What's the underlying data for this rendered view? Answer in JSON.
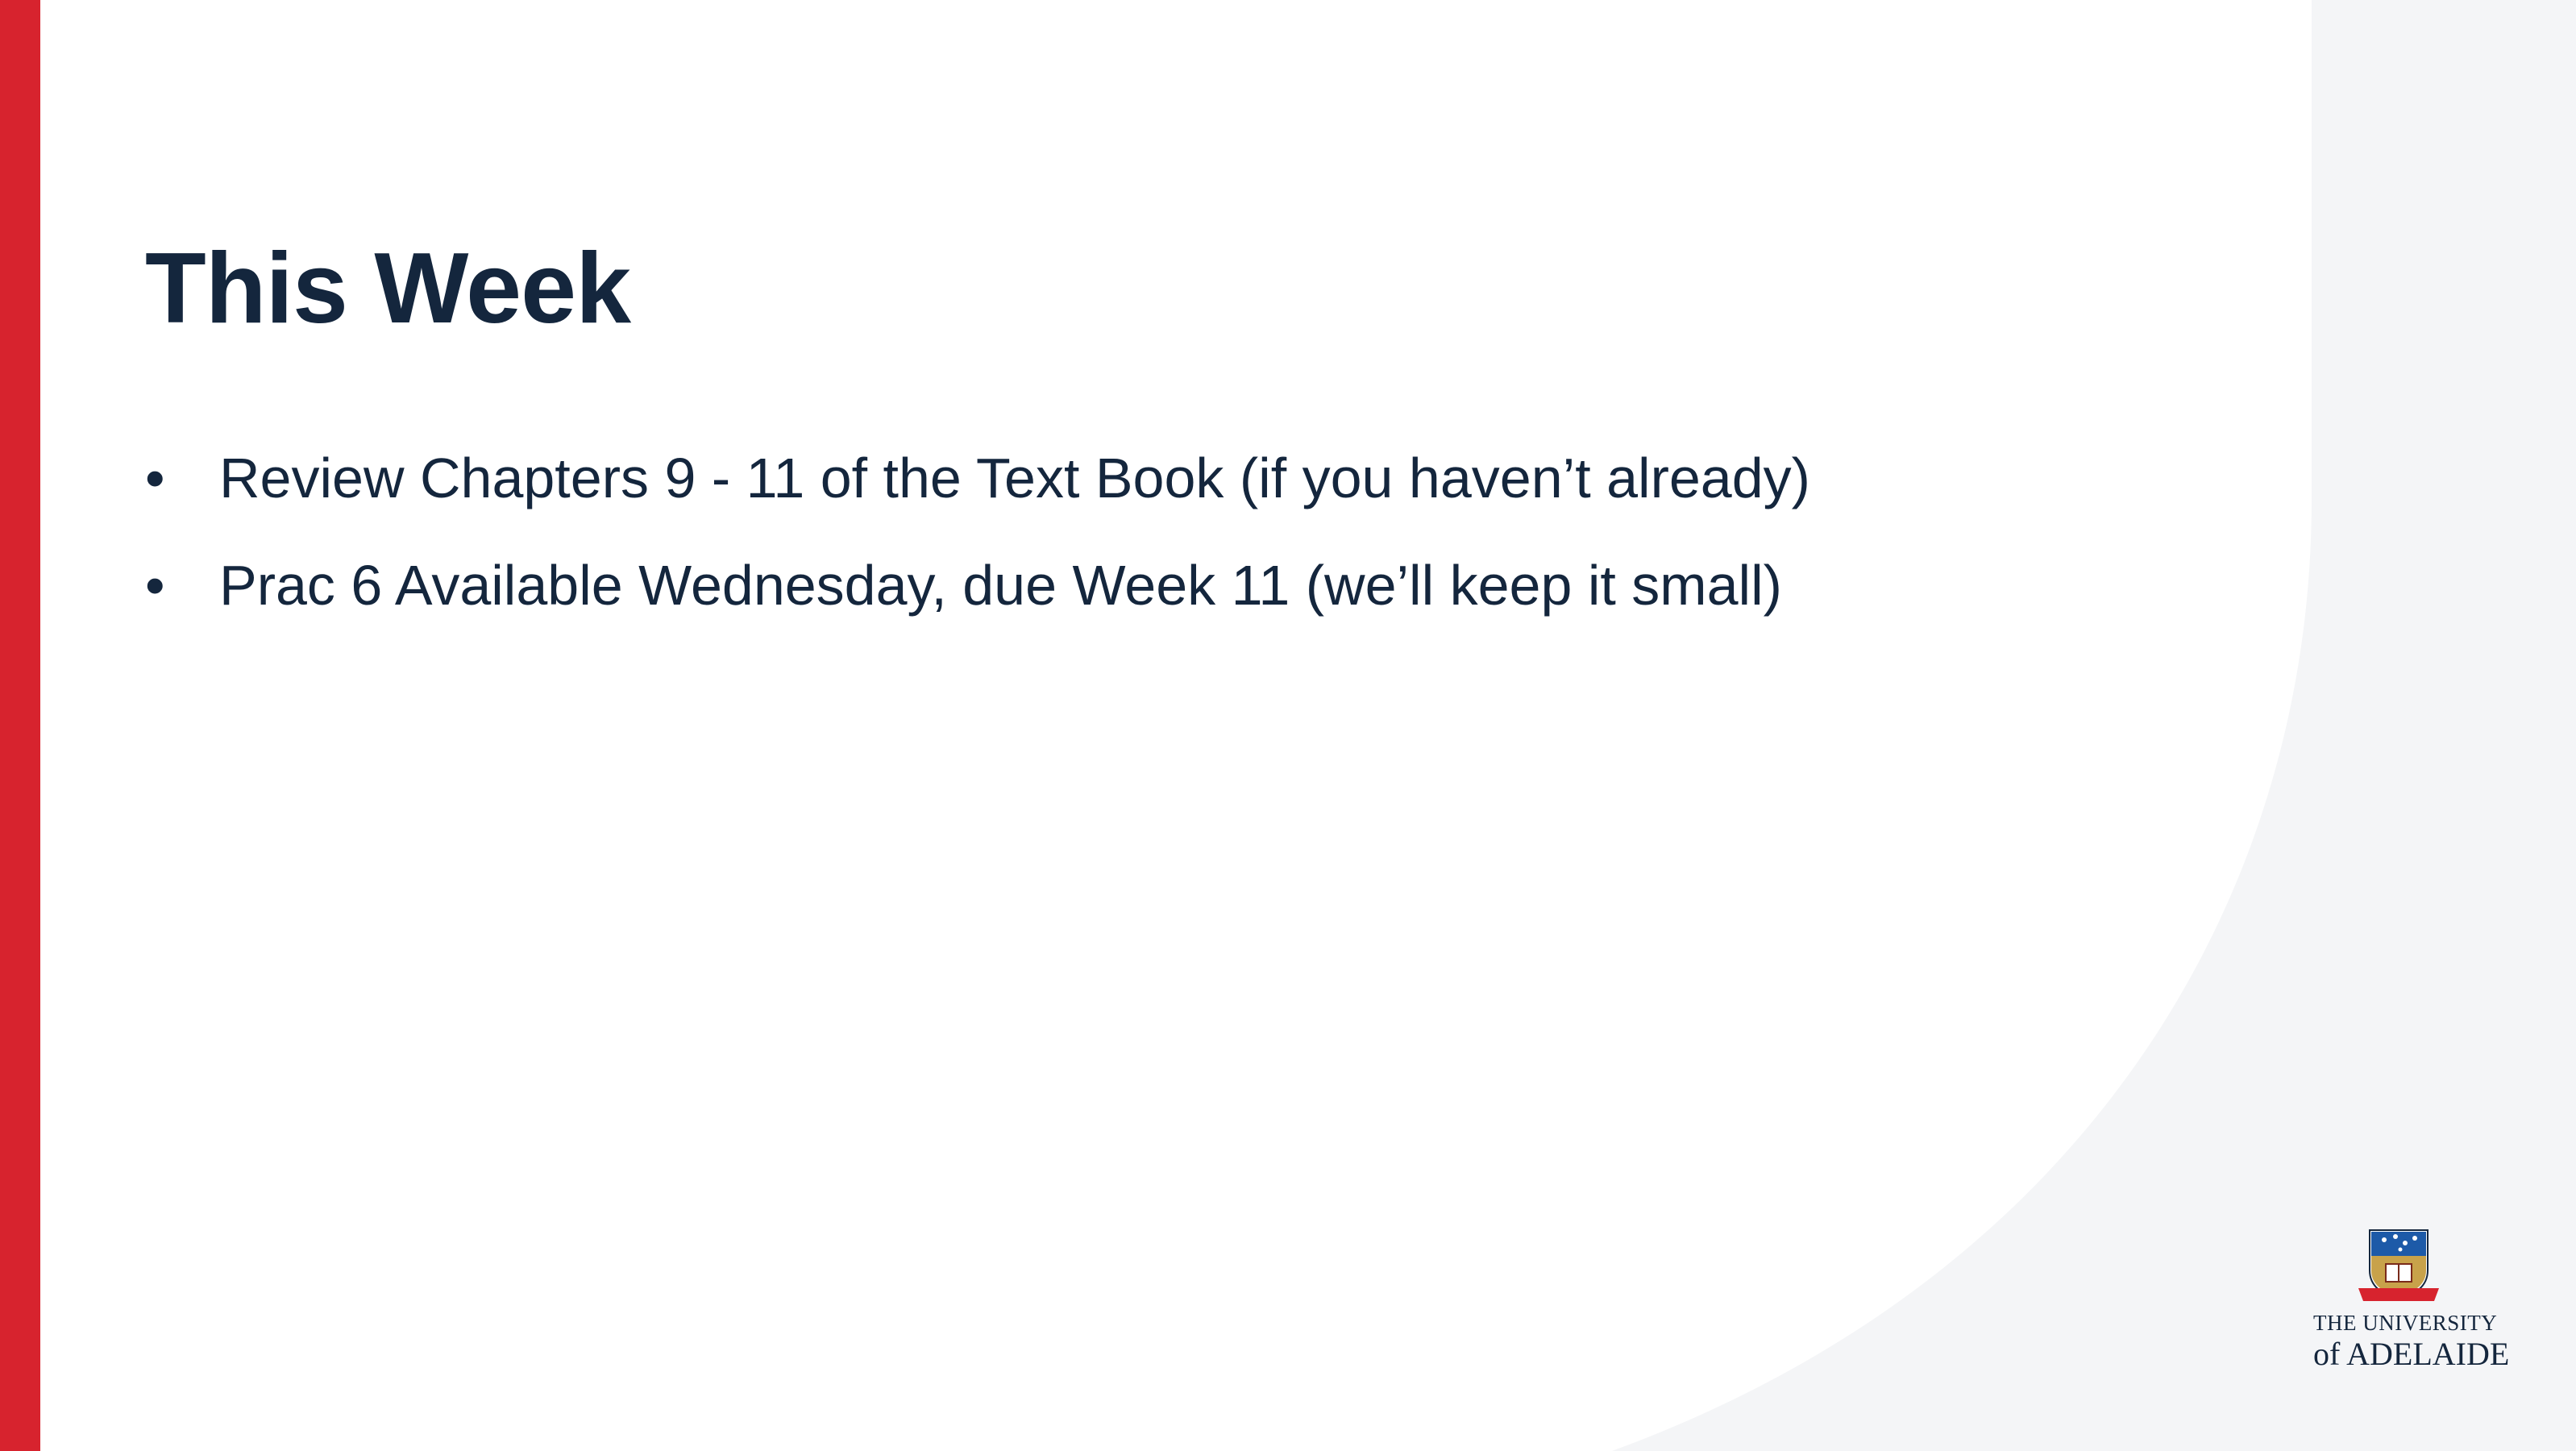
{
  "slide": {
    "title": "This Week",
    "bullets": [
      {
        "marker": "•",
        "text": "Review Chapters 9 - 11 of the Text Book (if you haven’t already)"
      },
      {
        "marker": "•",
        "text": "Prac 6 Available Wednesday, due Week 11 (we’ll keep it small)"
      }
    ]
  },
  "logo": {
    "name": "university-crest-icon",
    "line1": "THE UNIVERSITY",
    "line2": "of ADELAIDE"
  },
  "colors": {
    "accent_red": "#d7232e",
    "text_navy": "#14263d",
    "background": "#ffffff",
    "curve_gray": "#f4f5f7"
  }
}
